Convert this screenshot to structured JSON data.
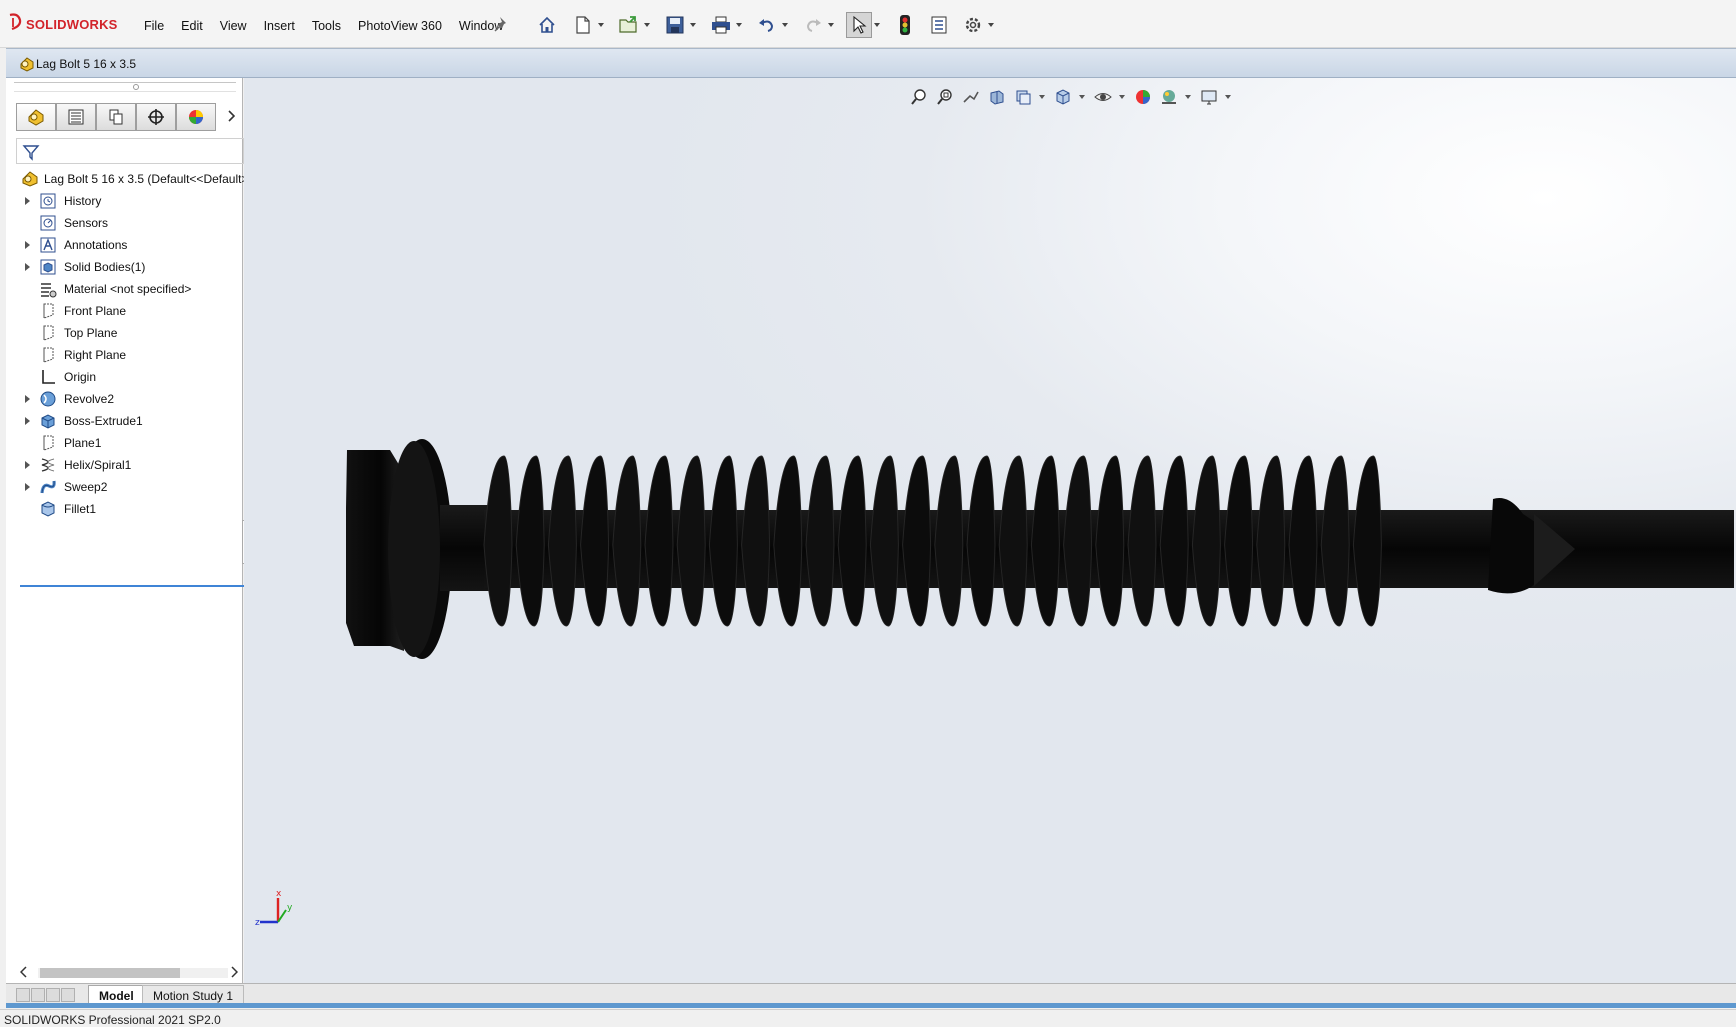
{
  "app": {
    "name": "SOLIDWORKS",
    "brand_prefix": "3S"
  },
  "menus": [
    "File",
    "Edit",
    "View",
    "Insert",
    "Tools",
    "PhotoView 360",
    "Window"
  ],
  "toolbar_icons": [
    "home-icon",
    "new-document-icon",
    "open-icon",
    "save-icon",
    "print-icon",
    "undo-icon",
    "redo-icon",
    "select-icon",
    "rebuild-icon",
    "file-properties-icon",
    "options-icon"
  ],
  "document": {
    "title": "Lag Bolt 5 16 x 3.5"
  },
  "feature_manager": {
    "root_label": "Lag Bolt 5 16 x 3.5  (Default<<Default>",
    "items": [
      {
        "label": "History",
        "expandable": true,
        "icon": "history-icon"
      },
      {
        "label": "Sensors",
        "expandable": false,
        "icon": "sensors-icon"
      },
      {
        "label": "Annotations",
        "expandable": true,
        "icon": "annotations-icon"
      },
      {
        "label": "Solid Bodies(1)",
        "expandable": true,
        "icon": "solid-bodies-icon"
      },
      {
        "label": "Material <not specified>",
        "expandable": false,
        "icon": "material-icon"
      },
      {
        "label": "Front Plane",
        "expandable": false,
        "icon": "plane-icon"
      },
      {
        "label": "Top Plane",
        "expandable": false,
        "icon": "plane-icon"
      },
      {
        "label": "Right Plane",
        "expandable": false,
        "icon": "plane-icon"
      },
      {
        "label": "Origin",
        "expandable": false,
        "icon": "origin-icon"
      },
      {
        "label": "Revolve2",
        "expandable": true,
        "icon": "revolve-icon"
      },
      {
        "label": "Boss-Extrude1",
        "expandable": true,
        "icon": "extrude-icon"
      },
      {
        "label": "Plane1",
        "expandable": false,
        "icon": "plane-icon"
      },
      {
        "label": "Helix/Spiral1",
        "expandable": true,
        "icon": "helix-icon"
      },
      {
        "label": "Sweep2",
        "expandable": true,
        "icon": "sweep-icon"
      },
      {
        "label": "Fillet1",
        "expandable": false,
        "icon": "fillet-icon"
      }
    ]
  },
  "bottom_tabs": {
    "model": "Model",
    "motion": "Motion Study 1"
  },
  "status": {
    "text": "SOLIDWORKS Professional 2021 SP2.0"
  },
  "triad": {
    "x": "x",
    "y": "y",
    "z": "z"
  },
  "colors": {
    "brand_red": "#d2232a",
    "selection_blue": "#3f84d6",
    "model_black": "#0b0b0b"
  }
}
